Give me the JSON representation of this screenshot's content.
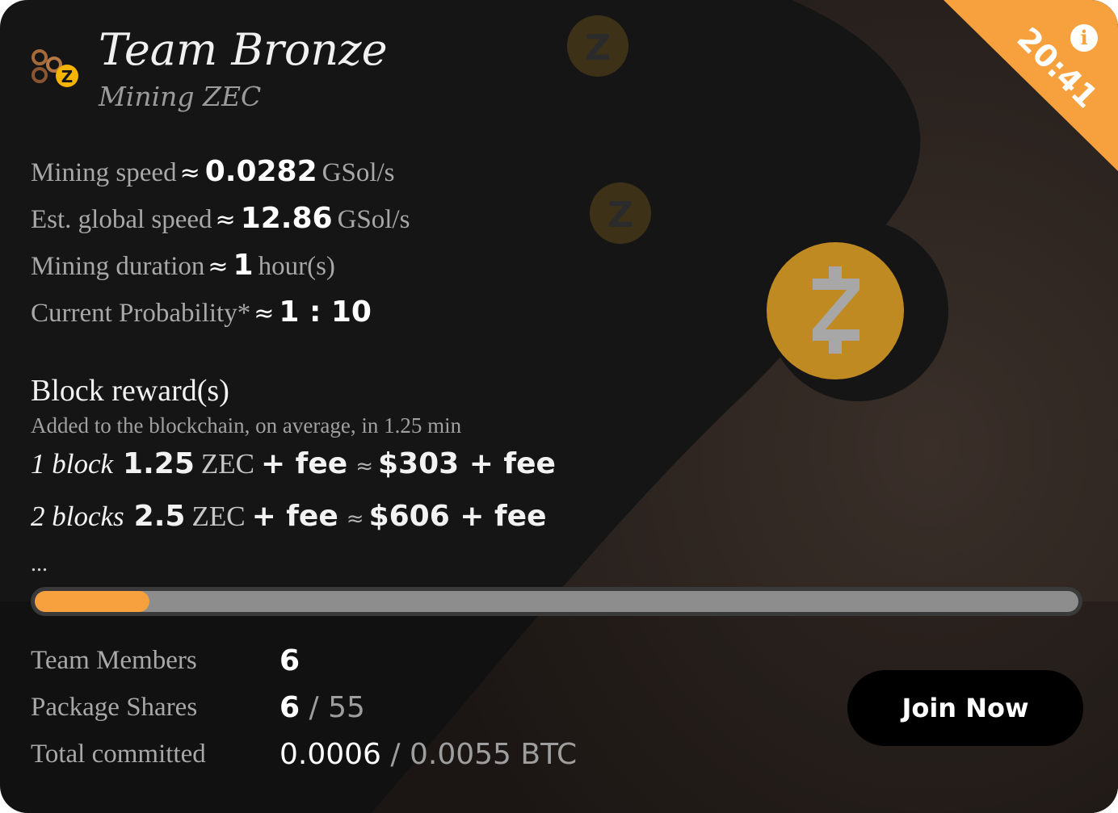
{
  "colors": {
    "accent": "#f7a13e",
    "background": "#151515",
    "coin": "#c08a22"
  },
  "team": {
    "name": "Team Bronze",
    "subtitle": "Mining ZEC",
    "icon": "bronze-team-zec-icon"
  },
  "timer": "20:41",
  "info_icon_label": "i",
  "stats": [
    {
      "label": "Mining speed",
      "approx": "≈",
      "value": "0.0282",
      "unit": "GSol/s"
    },
    {
      "label": "Est. global speed",
      "approx": "≈",
      "value": "12.86",
      "unit": "GSol/s"
    },
    {
      "label": "Mining duration",
      "approx": "≈",
      "value": "1",
      "unit": "hour(s)"
    },
    {
      "label": "Current Probability*",
      "approx": "≈",
      "value": "1 : 10",
      "unit": ""
    }
  ],
  "rewards": {
    "heading": "Block reward(s)",
    "subheading": "Added to the blockchain, on average, in 1.25 min",
    "rows": [
      {
        "label": "1 block",
        "amount": "1.25",
        "currency": "ZEC",
        "plus": "+ fee",
        "approx": "≈",
        "usd": "$303 + fee"
      },
      {
        "label": "2 blocks",
        "amount": "2.5",
        "currency": "ZEC",
        "plus": "+ fee",
        "approx": "≈",
        "usd": "$606 + fee"
      }
    ],
    "more": "..."
  },
  "progress": {
    "fraction": 0.11
  },
  "info": {
    "members_label": "Team Members",
    "members_value": "6",
    "shares_label": "Package Shares",
    "shares_value": "6",
    "shares_separator": " / ",
    "shares_total": "55",
    "committed_label": "Total committed",
    "committed_value": "0.0006",
    "committed_separator": " / ",
    "committed_total": "0.0055 BTC"
  },
  "join_button": "Join Now"
}
